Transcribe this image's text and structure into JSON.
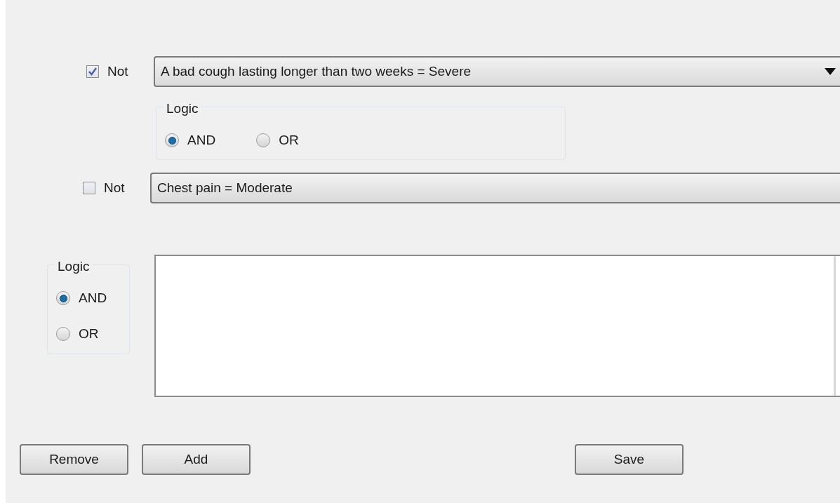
{
  "conditions": [
    {
      "not_label": "Not",
      "not_checked": true,
      "value": "A bad cough lasting longer than two weeks = Severe",
      "arrow": true
    },
    {
      "not_label": "Not",
      "not_checked": false,
      "value": "Chest pain = Moderate",
      "arrow": false
    }
  ],
  "inner_logic": {
    "title": "Logic",
    "options": [
      {
        "label": "AND",
        "selected": true
      },
      {
        "label": "OR",
        "selected": false
      }
    ]
  },
  "outer_logic": {
    "title": "Logic",
    "options": [
      {
        "label": "AND",
        "selected": true
      },
      {
        "label": "OR",
        "selected": false
      }
    ]
  },
  "buttons": [
    {
      "label": "Remove"
    },
    {
      "label": "Add"
    },
    {
      "label": "Save"
    }
  ]
}
